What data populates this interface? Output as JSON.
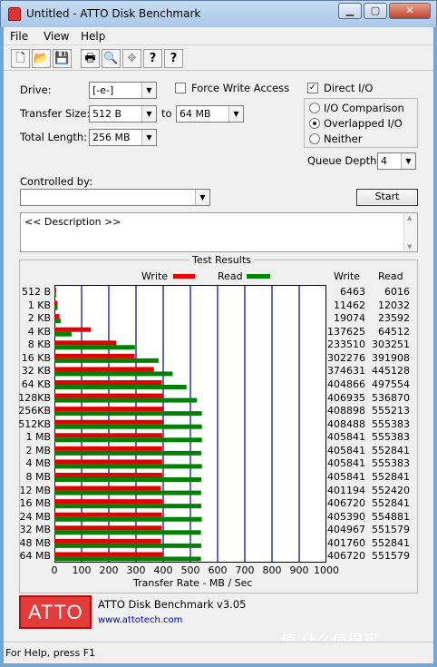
{
  "window": {
    "title": "Untitled - ATTO Disk Benchmark"
  },
  "menu": [
    "File",
    "View",
    "Help"
  ],
  "toolbar": {
    "new": "🗋",
    "open": "📂",
    "save": "💾",
    "print": "🖶",
    "preview": "🔍",
    "move": "✥",
    "help": "?",
    "context_help": "?"
  },
  "form": {
    "drive_label": "Drive:",
    "drive_value": "[-e-]",
    "force_write_label": "Force Write Access",
    "direct_io_label": "Direct I/O",
    "transfer_size_label": "Transfer Size:",
    "transfer_from": "512 B",
    "to_label": "to",
    "transfer_to": "64 MB",
    "total_length_label": "Total Length:",
    "total_length_value": "256 MB",
    "io_comparison_label": "I/O Comparison",
    "overlapped_io_label": "Overlapped I/O",
    "neither_label": "Neither",
    "queue_depth_label": "Queue Depth:",
    "queue_depth_value": "4",
    "controlled_by_label": "Controlled by:",
    "controlled_by_value": "",
    "start_label": "Start",
    "description": "<< Description >>"
  },
  "results": {
    "title": "Test Results",
    "legend_write": "Write",
    "legend_read": "Read",
    "col_write": "Write",
    "col_read": "Read",
    "rows": [
      {
        "label": "512 B",
        "write": "6463",
        "read": "6016"
      },
      {
        "label": "1 KB",
        "write": "11462",
        "read": "12032"
      },
      {
        "label": "2 KB",
        "write": "19074",
        "read": "23592"
      },
      {
        "label": "4 KB",
        "write": "137625",
        "read": "64512"
      },
      {
        "label": "8 KB",
        "write": "233510",
        "read": "303251"
      },
      {
        "label": "16 KB",
        "write": "302276",
        "read": "391908"
      },
      {
        "label": "32 KB",
        "write": "374631",
        "read": "445128"
      },
      {
        "label": "64 KB",
        "write": "404866",
        "read": "497554"
      },
      {
        "label": "128KB",
        "write": "406935",
        "read": "536870"
      },
      {
        "label": "256KB",
        "write": "408898",
        "read": "555213"
      },
      {
        "label": "512KB",
        "write": "408488",
        "read": "555383"
      },
      {
        "label": "1 MB",
        "write": "405841",
        "read": "555383"
      },
      {
        "label": "2 MB",
        "write": "405841",
        "read": "552841"
      },
      {
        "label": "4 MB",
        "write": "405841",
        "read": "555383"
      },
      {
        "label": "8 MB",
        "write": "405841",
        "read": "552841"
      },
      {
        "label": "12 MB",
        "write": "401194",
        "read": "552420"
      },
      {
        "label": "16 MB",
        "write": "406720",
        "read": "552841"
      },
      {
        "label": "24 MB",
        "write": "405390",
        "read": "554881"
      },
      {
        "label": "32 MB",
        "write": "404967",
        "read": "551579"
      },
      {
        "label": "48 MB",
        "write": "401760",
        "read": "552841"
      },
      {
        "label": "64 MB",
        "write": "406720",
        "read": "551579"
      }
    ],
    "axis_ticks": [
      "0",
      "100",
      "200",
      "300",
      "400",
      "500",
      "600",
      "700",
      "800",
      "900",
      "1000"
    ],
    "axis_label": "Transfer Rate - MB / Sec"
  },
  "footer": {
    "logo": "ATTO",
    "product": "ATTO Disk Benchmark v3.05",
    "url": "www.attotech.com",
    "watermark": "值 什么值得买"
  },
  "status": "For Help, press F1",
  "colors": {
    "write": "#e00000",
    "read": "#008000",
    "logo": "#e63b3b"
  }
}
